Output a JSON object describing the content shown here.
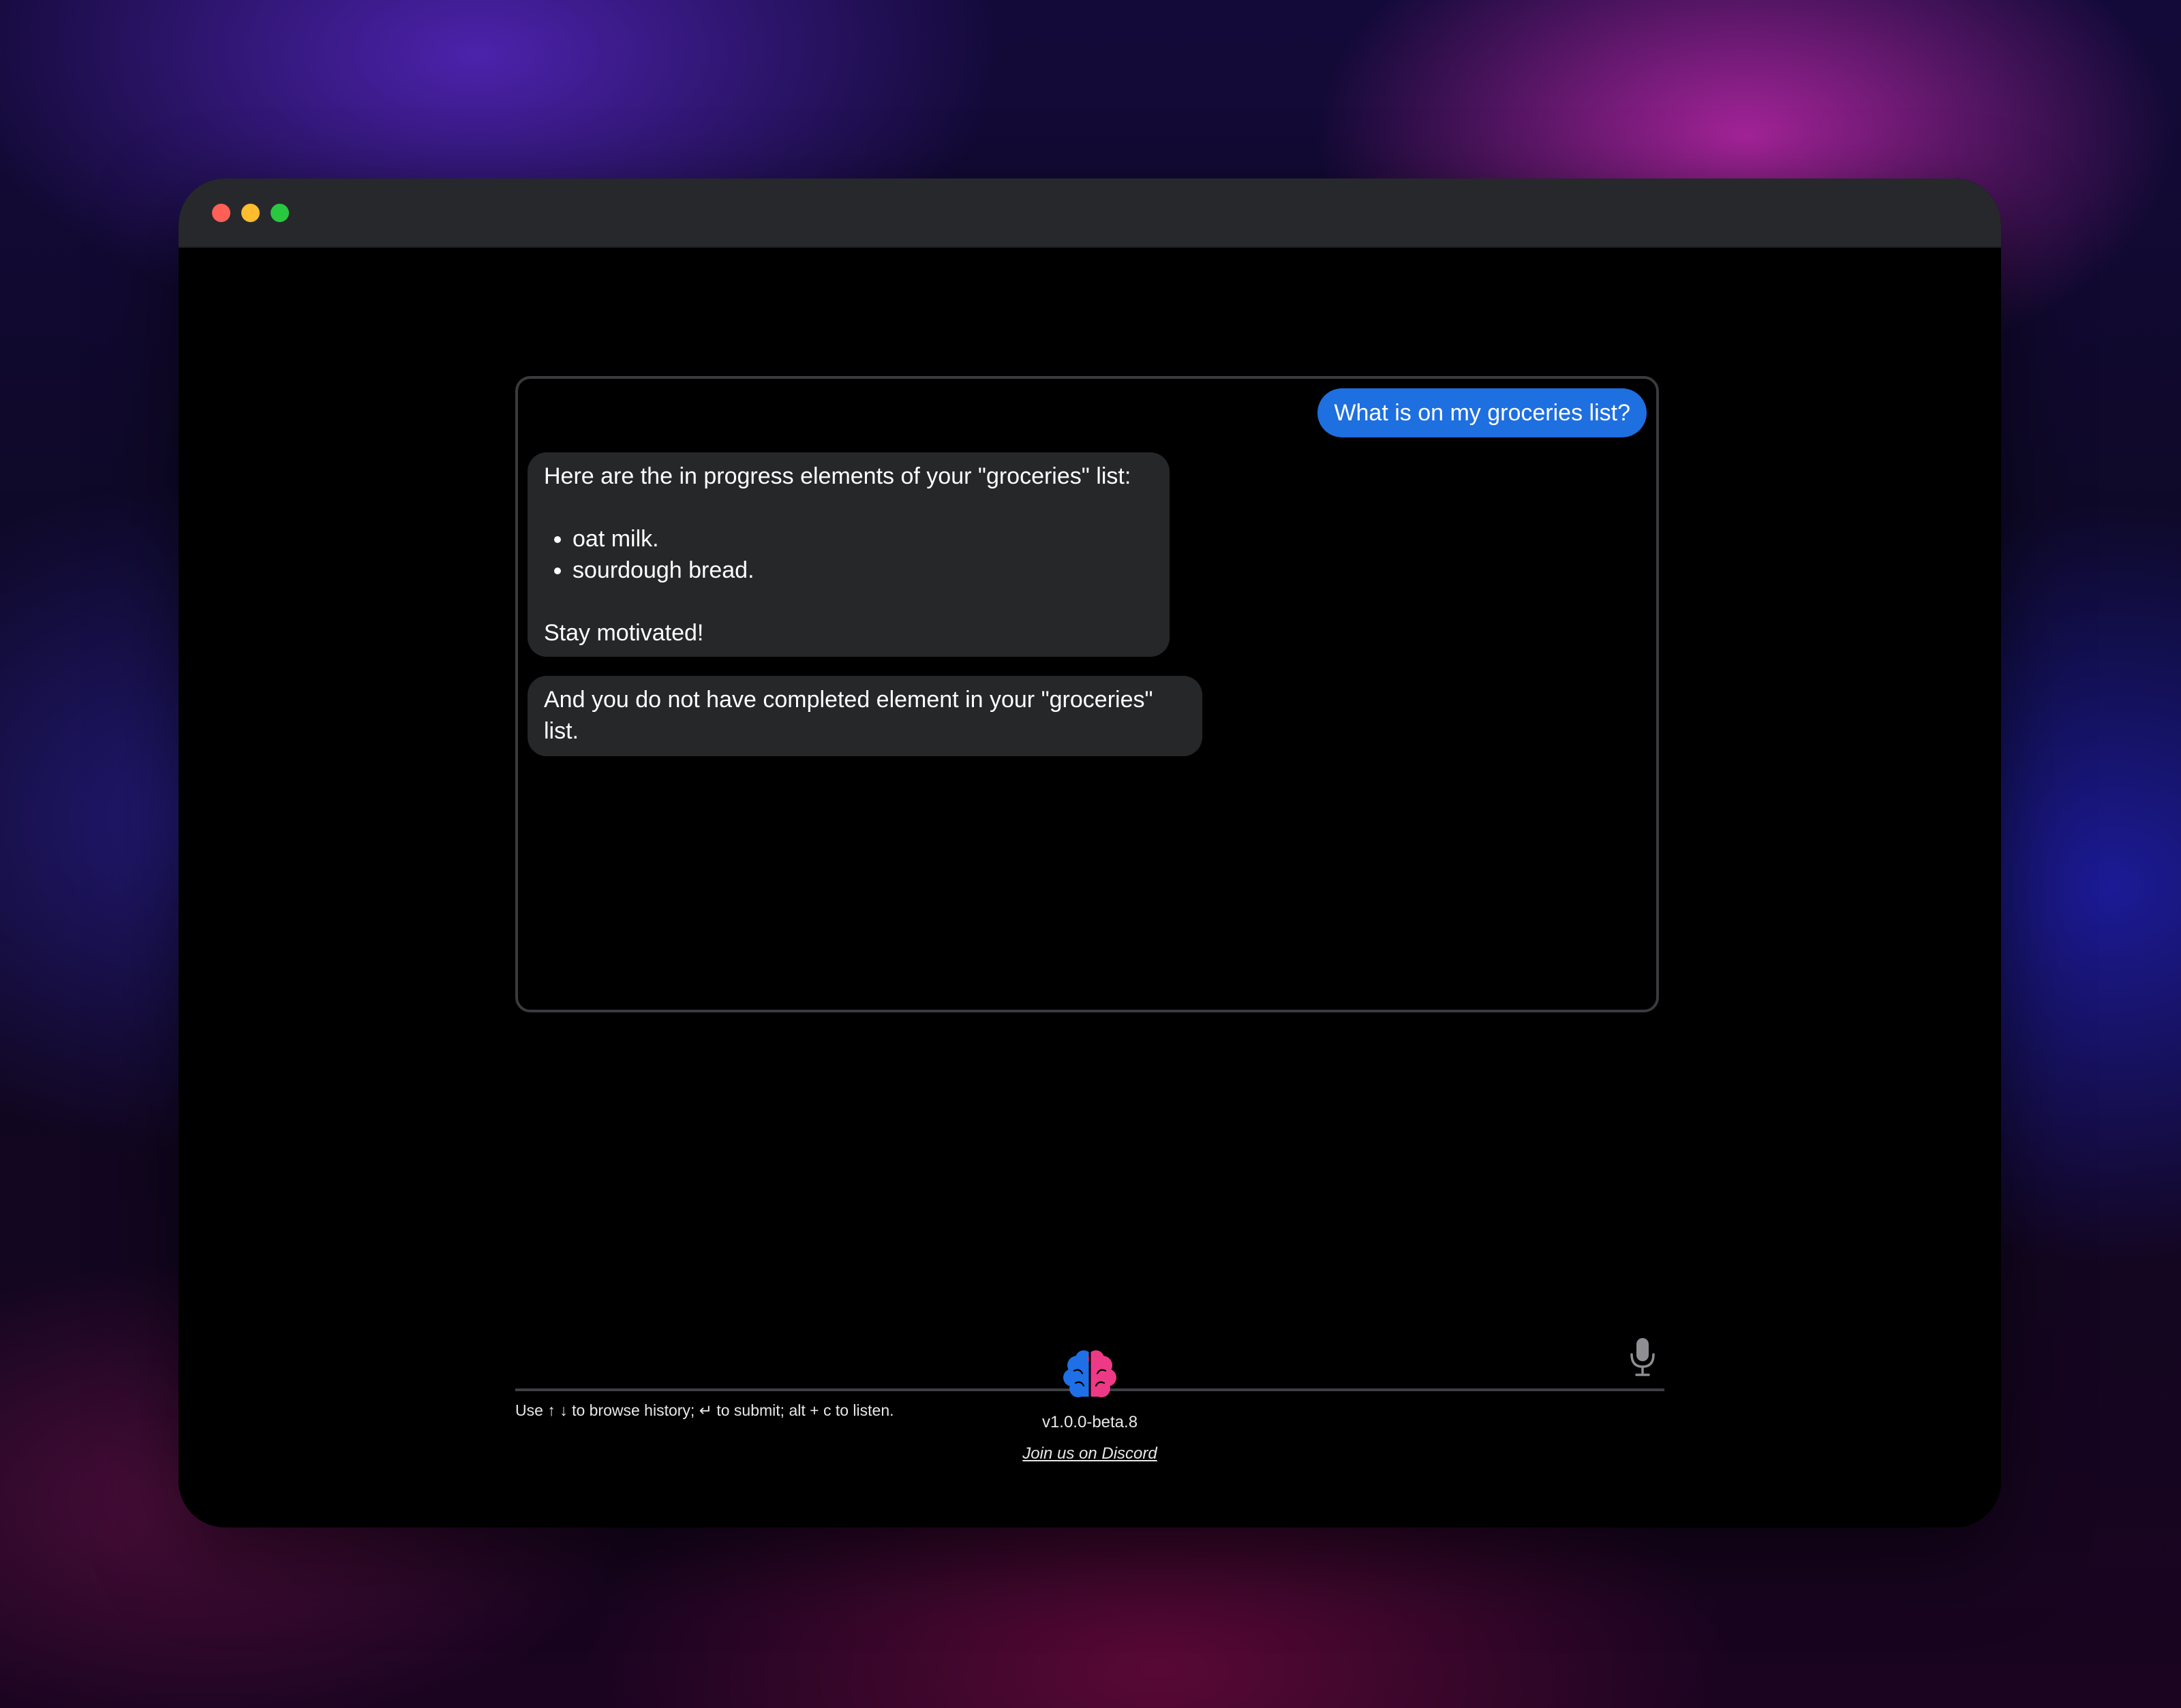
{
  "chat": {
    "messages": [
      {
        "role": "user",
        "text": "What is on my groceries list?"
      },
      {
        "role": "assistant",
        "intro": "Here are the in progress elements of your \"groceries\" list:",
        "items": [
          "oat milk.",
          "sourdough bread."
        ],
        "outro": "Stay motivated!"
      },
      {
        "role": "assistant",
        "text": "And you do not have completed element in your \"groceries\" list."
      }
    ]
  },
  "input": {
    "value": "",
    "mic_icon": "microphone-icon"
  },
  "hint": "Use ↑ ↓ to browse history; ↵ to submit; alt + c to listen.",
  "footer": {
    "logo_icon": "brain-icon",
    "version": "v1.0.0-beta.8",
    "discord_link": "Join us on Discord"
  },
  "colors": {
    "user_bubble": "#1e6fe0",
    "assistant_bubble": "#262729",
    "window_bg": "#000000",
    "titlebar": "#27282b",
    "traffic_red": "#fe5f57",
    "traffic_yellow": "#febc2e",
    "traffic_green": "#28c840",
    "logo_blue": "#1f6fe6",
    "logo_pink": "#ee3a86"
  }
}
